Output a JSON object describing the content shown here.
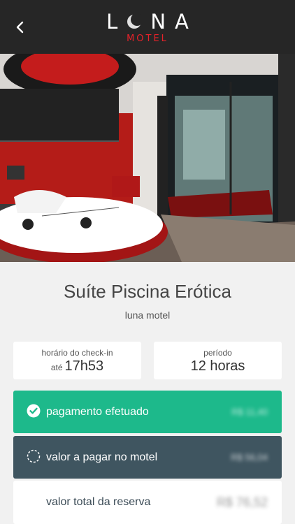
{
  "header": {
    "brand_name": "L NA",
    "brand_sub": "MOTEL",
    "accent_color": "#e8222a",
    "back_icon": "chevron-left-icon"
  },
  "suite": {
    "title": "Suíte Piscina Erótica",
    "subtitle": "luna motel"
  },
  "checkin": {
    "label": "horário do check-in",
    "prefix": "até",
    "time": "17h53"
  },
  "period": {
    "label": "período",
    "value": "12 horas"
  },
  "payments": {
    "paid": {
      "label": "pagamento efetuado",
      "amount": "R$ 11,40",
      "icon": "check-circle-icon",
      "color": "#1db98b"
    },
    "due": {
      "label": "valor a pagar no motel",
      "amount": "R$ 56,04",
      "icon": "dashed-circle-icon",
      "color": "#3f5560"
    },
    "total": {
      "label": "valor total da reserva",
      "amount": "R$ 76,52"
    }
  }
}
